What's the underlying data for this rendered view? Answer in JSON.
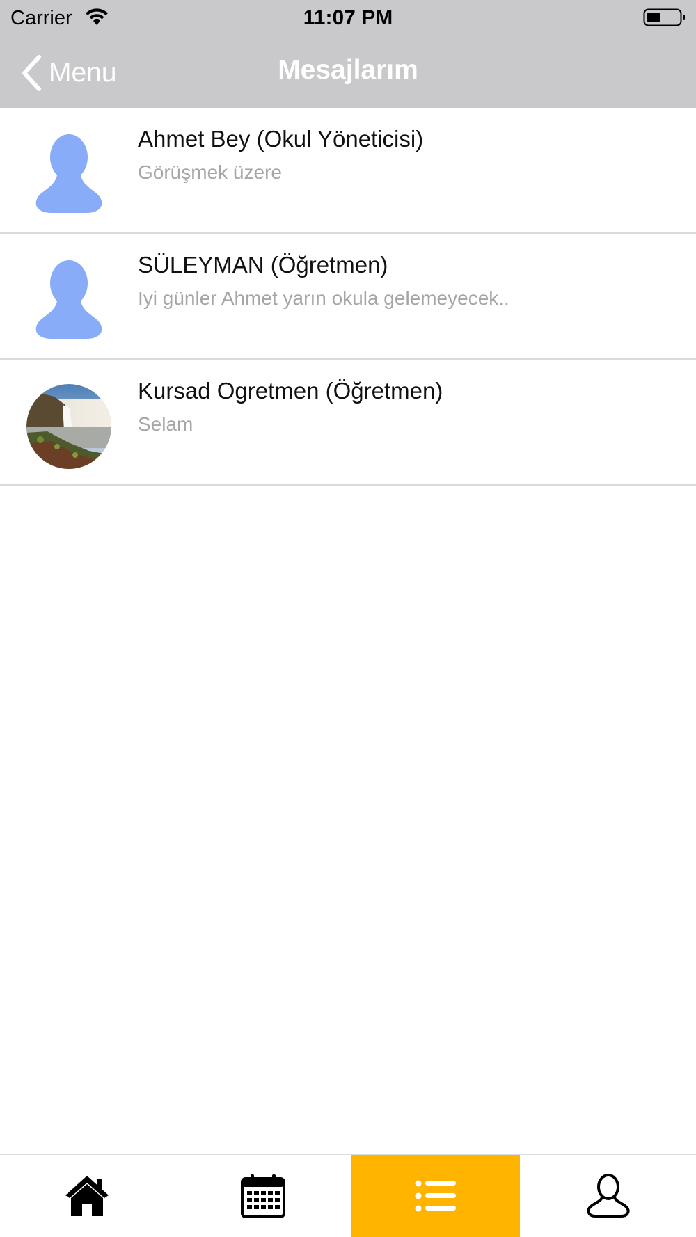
{
  "status_bar": {
    "carrier": "Carrier",
    "time": "11:07 PM",
    "wifi_icon": "wifi-icon",
    "battery_icon": "battery-icon"
  },
  "nav": {
    "back_label": "Menu",
    "back_icon": "chevron-left-icon",
    "title": "Mesajlarım"
  },
  "conversations": [
    {
      "name": "Ahmet Bey (Okul Yöneticisi)",
      "preview": "Görüşmek üzere",
      "avatar": "default-person-avatar"
    },
    {
      "name": "SÜLEYMAN (Öğretmen)",
      "preview": "Iyi günler Ahmet yarın okula gelemeyecek..",
      "avatar": "default-person-avatar"
    },
    {
      "name": "Kursad Ogretmen (Öğretmen)",
      "preview": "Selam",
      "avatar": "waterfall-photo-avatar"
    }
  ],
  "tab_bar": {
    "tabs": [
      {
        "icon": "home-icon",
        "active": false
      },
      {
        "icon": "calendar-icon",
        "active": false
      },
      {
        "icon": "list-icon",
        "active": true
      },
      {
        "icon": "profile-icon",
        "active": false
      }
    ],
    "active_color": "#ffb400"
  },
  "colors": {
    "header_bg": "#c9c9cb",
    "avatar_placeholder": "#88acf7",
    "preview_text": "#a5a5a5"
  }
}
